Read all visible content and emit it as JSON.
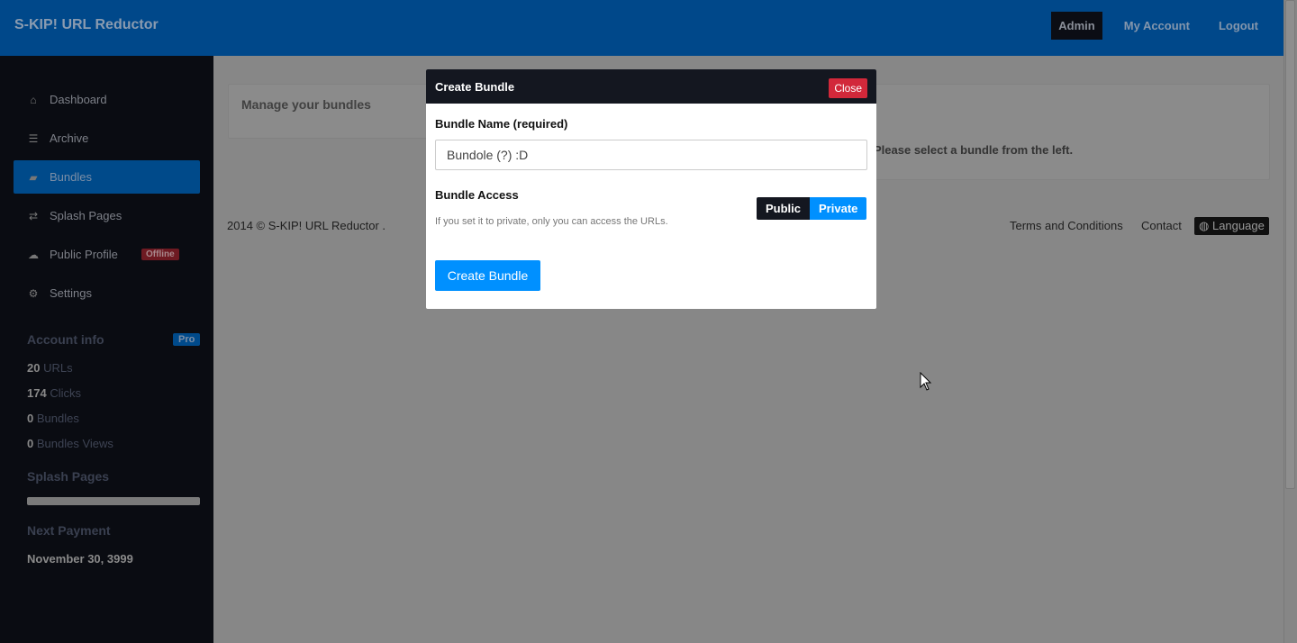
{
  "header": {
    "brand": "S-KIP! URL Reductor",
    "nav": [
      "Admin",
      "My Account",
      "Logout"
    ]
  },
  "sidebar": {
    "items": [
      {
        "label": "Dashboard",
        "icon": "home-icon"
      },
      {
        "label": "Archive",
        "icon": "list-icon"
      },
      {
        "label": "Bundles",
        "icon": "folder-open-icon"
      },
      {
        "label": "Splash Pages",
        "icon": "transfer-icon"
      },
      {
        "label": "Public Profile",
        "icon": "cloud-icon",
        "badge": "Offline"
      },
      {
        "label": "Settings",
        "icon": "gear-icon"
      }
    ],
    "account_title": "Account info",
    "account_badge": "Pro",
    "stats": [
      {
        "n": "20",
        "l": "URLs"
      },
      {
        "n": "174",
        "l": "Clicks"
      },
      {
        "n": "0",
        "l": "Bundles"
      },
      {
        "n": "0",
        "l": "Bundles Views"
      }
    ],
    "splash_title": "Splash Pages",
    "splash_progress": 0,
    "payment_title": "Next Payment",
    "payment_date": "November 30, 3999"
  },
  "main": {
    "panel_title": "Manage your bundles",
    "hint": "Please select a bundle from the left."
  },
  "footer": {
    "copyright": "2014 © S-KIP! URL Reductor .",
    "links": [
      "Terms and Conditions",
      "Contact"
    ],
    "language": "Language"
  },
  "modal": {
    "title": "Create Bundle",
    "close": "Close",
    "name_label": "Bundle Name (required)",
    "name_value": "Bundole (?) :D",
    "access_label": "Bundle Access",
    "access_help": "If you set it to private, only you can access the URLs.",
    "public": "Public",
    "private": "Private",
    "submit": "Create Bundle"
  }
}
